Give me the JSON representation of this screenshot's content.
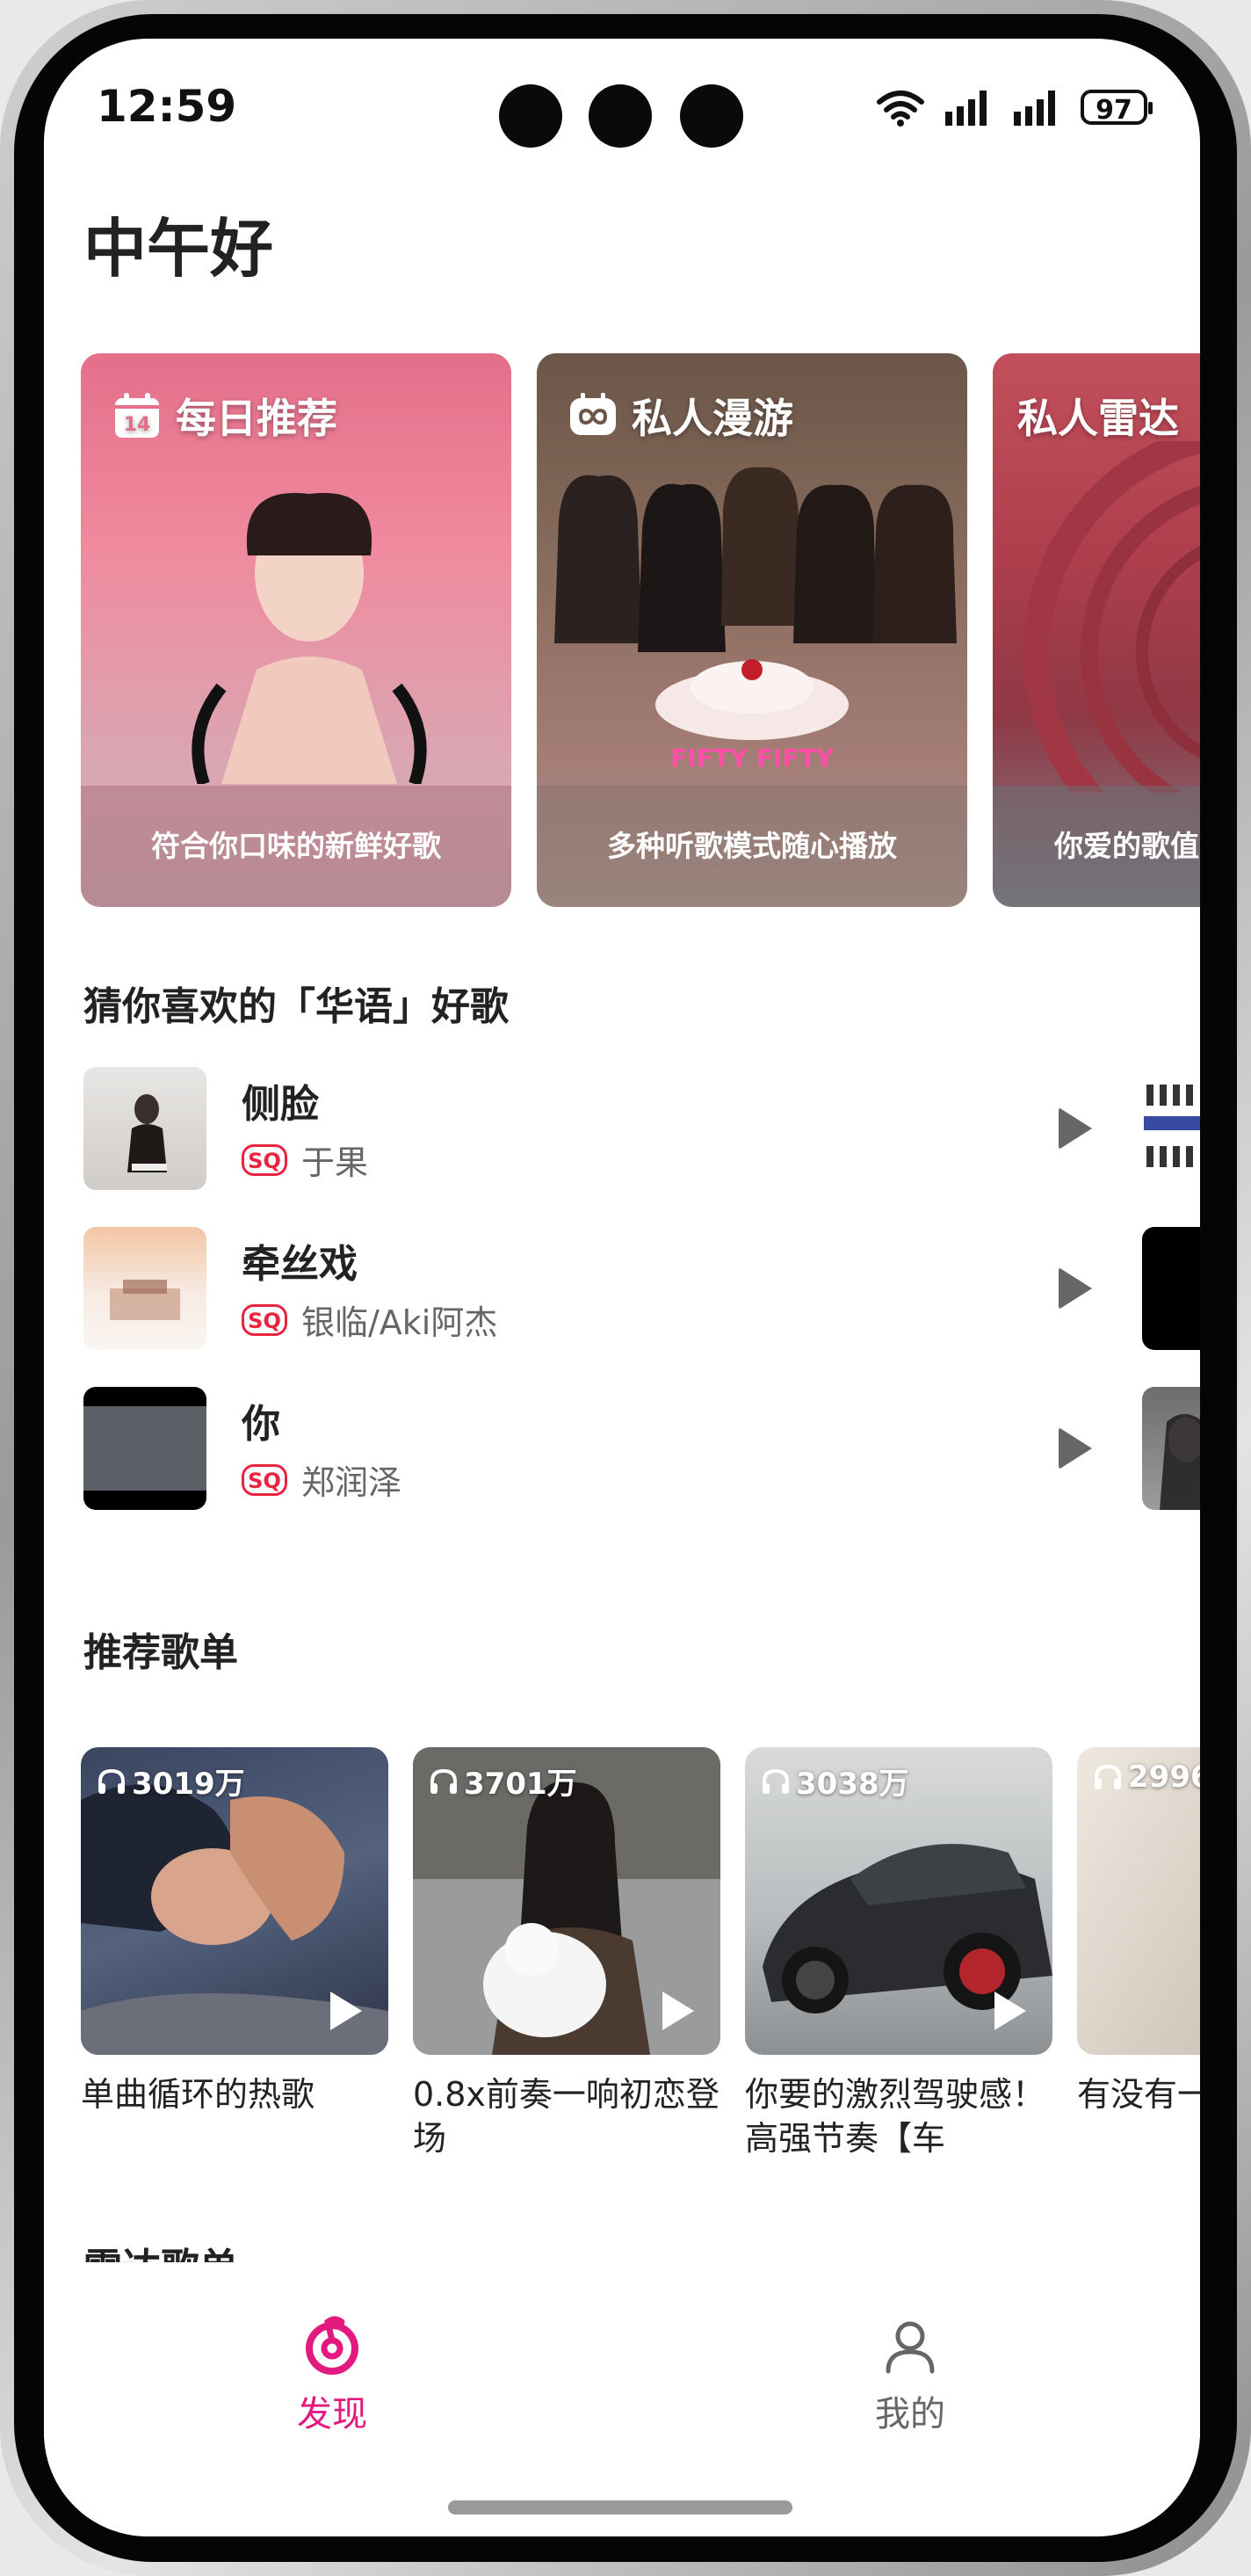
{
  "status_bar": {
    "time": "12:59",
    "battery": "97"
  },
  "greeting": "中午好",
  "feature_cards": [
    {
      "title": "每日推荐",
      "subtitle": "符合你口味的新鲜好歌",
      "icon": "calendar-icon",
      "calendar_day": "14"
    },
    {
      "title": "私人漫游",
      "subtitle": "多种听歌模式随心播放",
      "icon": "infinity-icon"
    },
    {
      "title": "私人雷达",
      "subtitle": "你爱的歌值",
      "icon": ""
    }
  ],
  "guess_section": {
    "title": "猜你喜欢的「华语」好歌",
    "badge": "SQ",
    "songs": [
      {
        "name": "侧脸",
        "artist": "于果"
      },
      {
        "name": "牵丝戏",
        "artist": "银临/Aki阿杰"
      },
      {
        "name": "你",
        "artist": "郑润泽"
      }
    ]
  },
  "playlist_section": {
    "title": "推荐歌单",
    "playlists": [
      {
        "count": "3019万",
        "name": "单曲循环的热歌"
      },
      {
        "count": "3701万",
        "name": "0.8x前奏一响初恋登场"
      },
      {
        "count": "3038万",
        "name": "你要的激烈驾驶感！高强节奏【车"
      },
      {
        "count": "2996",
        "name": "有没有一首歌戳内心"
      }
    ]
  },
  "radar_section": {
    "title": "雷达歌单"
  },
  "tab_bar": {
    "tabs": [
      {
        "label": "发现",
        "icon": "netease-music-icon",
        "active": true
      },
      {
        "label": "我的",
        "icon": "person-icon",
        "active": false
      }
    ]
  },
  "colors": {
    "accent": "#e3197f",
    "sq_red": "#e8243f",
    "inactive": "#666666"
  }
}
